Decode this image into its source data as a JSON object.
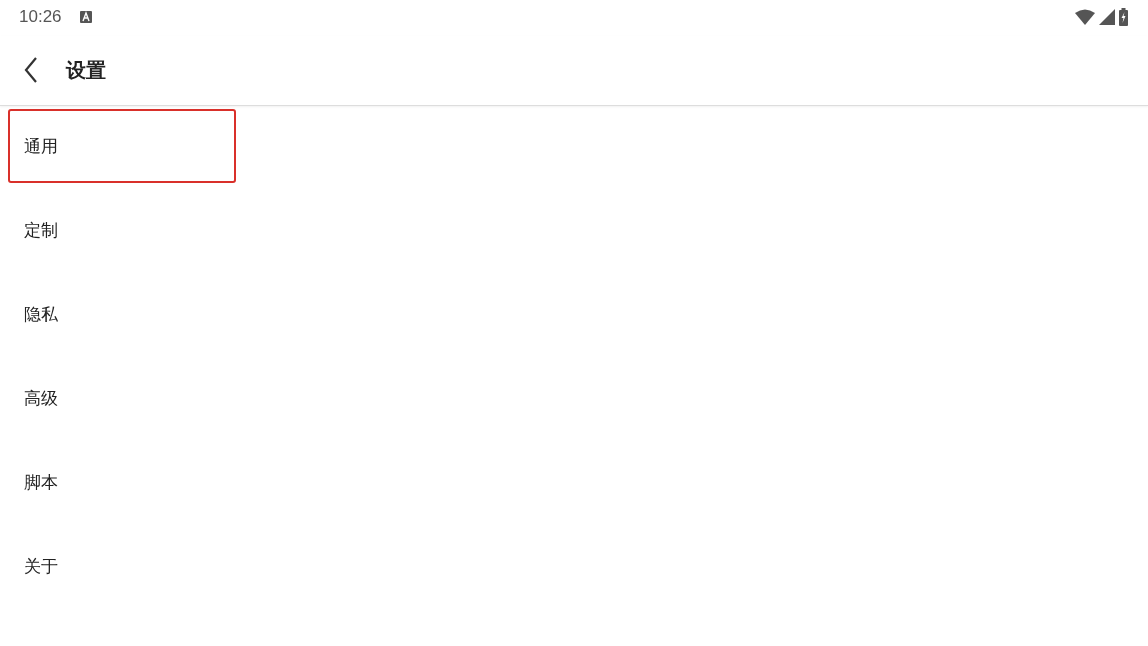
{
  "status_bar": {
    "time": "10:26"
  },
  "toolbar": {
    "title": "设置"
  },
  "menu": {
    "items": [
      {
        "label": "通用",
        "selected": true
      },
      {
        "label": "定制",
        "selected": false
      },
      {
        "label": "隐私",
        "selected": false
      },
      {
        "label": "高级",
        "selected": false
      },
      {
        "label": "脚本",
        "selected": false
      },
      {
        "label": "关于",
        "selected": false
      }
    ]
  }
}
